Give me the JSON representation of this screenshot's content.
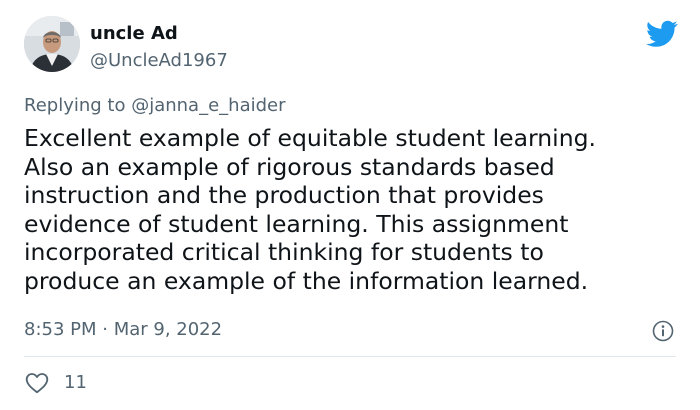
{
  "tweet": {
    "author": {
      "display_name": "uncle Ad",
      "handle": "@UncleAd1967"
    },
    "reply": {
      "prefix": "Replying to ",
      "mention": "@janna_e_haider"
    },
    "body_lines": [
      "Excellent example of equitable student learning.",
      "Also an example of rigorous standards based",
      "instruction and the production that provides",
      "evidence of student learning. This assignment",
      "incorporated critical thinking for students to",
      "produce an example of the information learned."
    ],
    "timestamp": "8:53 PM · Mar 9, 2022",
    "like_count": "11",
    "icons": {
      "logo": "twitter-bird-icon",
      "info": "info-icon",
      "like": "heart-icon"
    },
    "colors": {
      "brand": "#1d9bf0",
      "text": "#0f1419",
      "muted": "#536471",
      "divider": "#e1e8ed"
    }
  }
}
